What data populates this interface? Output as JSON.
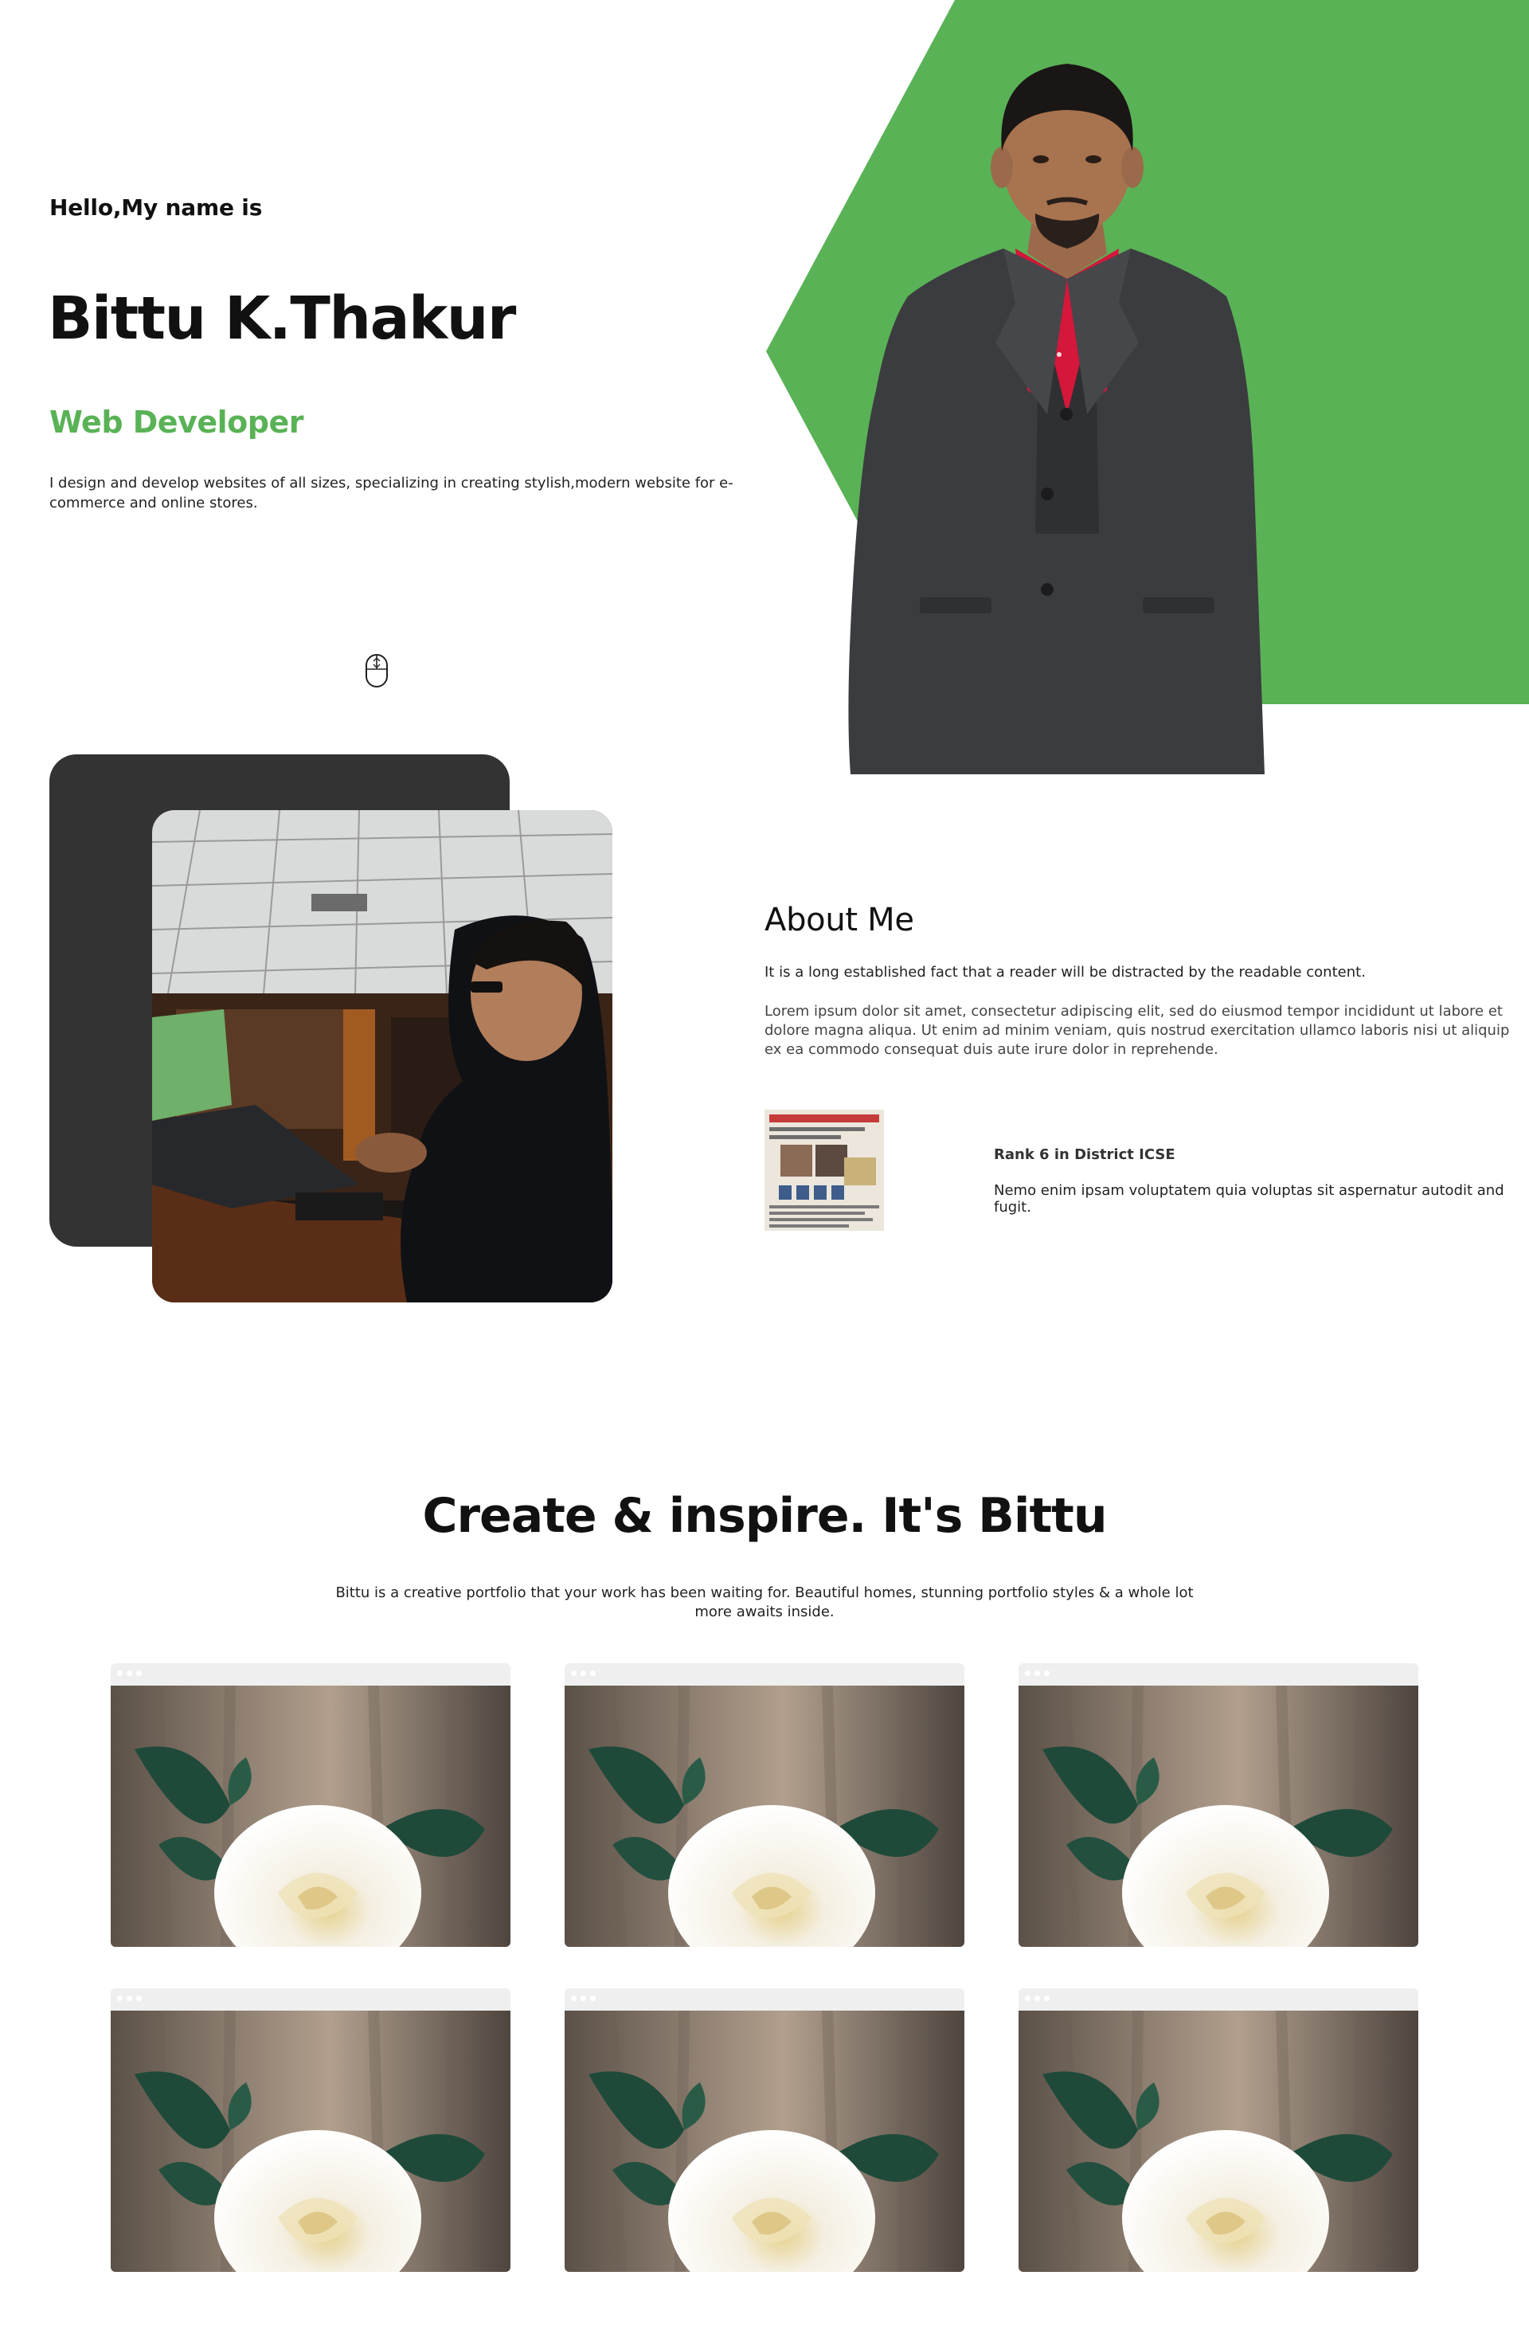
{
  "hero": {
    "greeting": "Hello,My name is",
    "name": "Bittu K.Thakur",
    "role": "Web Developer",
    "description": "I design and develop websites of all sizes, specializing in creating stylish,modern website for e-commerce and online stores."
  },
  "about": {
    "title": "About Me",
    "lead": "It is a long established fact that a reader will be distracted by the readable content.",
    "body": "Lorem ipsum dolor sit amet, consectetur adipiscing elit, sed do eiusmod tempor incididunt ut labore et dolore magna aliqua. Ut enim ad minim veniam, quis nostrud exercitation ullamco laboris nisi ut aliquip ex ea commodo consequat duis aute irure dolor in reprehende.",
    "achievement": {
      "title": "Rank 6 in District ICSE",
      "text": "Nemo enim ipsam voluptatem quia voluptas sit aspernatur autodit and fugit."
    }
  },
  "portfolio": {
    "title": "Create & inspire. It's Bittu",
    "description": "Bittu is a creative portfolio that your work has been waiting for. Beautiful homes, stunning portfolio styles & a whole lot more awaits inside.",
    "cards": [
      "rose",
      "rose",
      "rose",
      "rose",
      "rose",
      "rose"
    ]
  },
  "colors": {
    "accent": "#5ab256",
    "dark_panel": "#333333"
  }
}
